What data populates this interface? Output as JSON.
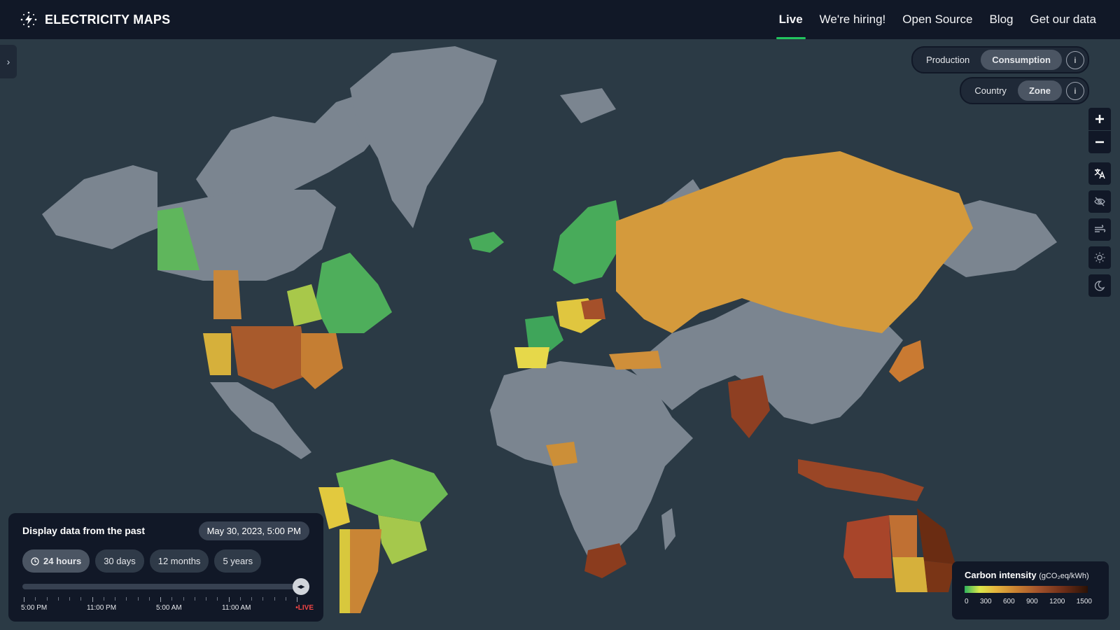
{
  "header": {
    "logo_text": "ELECTRICITY MAPS",
    "nav": [
      {
        "label": "Live",
        "active": true
      },
      {
        "label": "We're hiring!"
      },
      {
        "label": "Open Source"
      },
      {
        "label": "Blog"
      },
      {
        "label": "Get our data"
      }
    ]
  },
  "mode_toggle": {
    "options": [
      "Production",
      "Consumption"
    ],
    "selected": "Consumption",
    "info": "i"
  },
  "area_toggle": {
    "options": [
      "Country",
      "Zone"
    ],
    "selected": "Zone",
    "info": "i"
  },
  "map_controls": [
    "zoom-in-icon",
    "zoom-out-icon",
    "language-icon",
    "hide-icon",
    "wind-icon",
    "sun-icon",
    "dark-mode-icon"
  ],
  "past_panel": {
    "title": "Display data from the past",
    "date": "May 30, 2023, 5:00 PM",
    "ranges": [
      {
        "label": "24 hours",
        "selected": true
      },
      {
        "label": "30 days"
      },
      {
        "label": "12 months"
      },
      {
        "label": "5 years"
      }
    ],
    "slider_value": 1.0,
    "tick_labels": [
      "5:00 PM",
      "11:00 PM",
      "5:00 AM",
      "11:00 AM"
    ],
    "live_label": "LIVE"
  },
  "legend": {
    "title": "Carbon intensity",
    "unit": "(gCO₂eq/kWh)",
    "ticks": [
      "0",
      "300",
      "600",
      "900",
      "1200",
      "1500"
    ]
  },
  "colors": {
    "ocean": "#2b3a45",
    "no_data": "#7b8590",
    "low": "#2fb35c",
    "mid": "#d9b53c",
    "high": "#a3522b",
    "very_high": "#5a260f",
    "accent": "#22c55e",
    "live": "#ef4444"
  }
}
